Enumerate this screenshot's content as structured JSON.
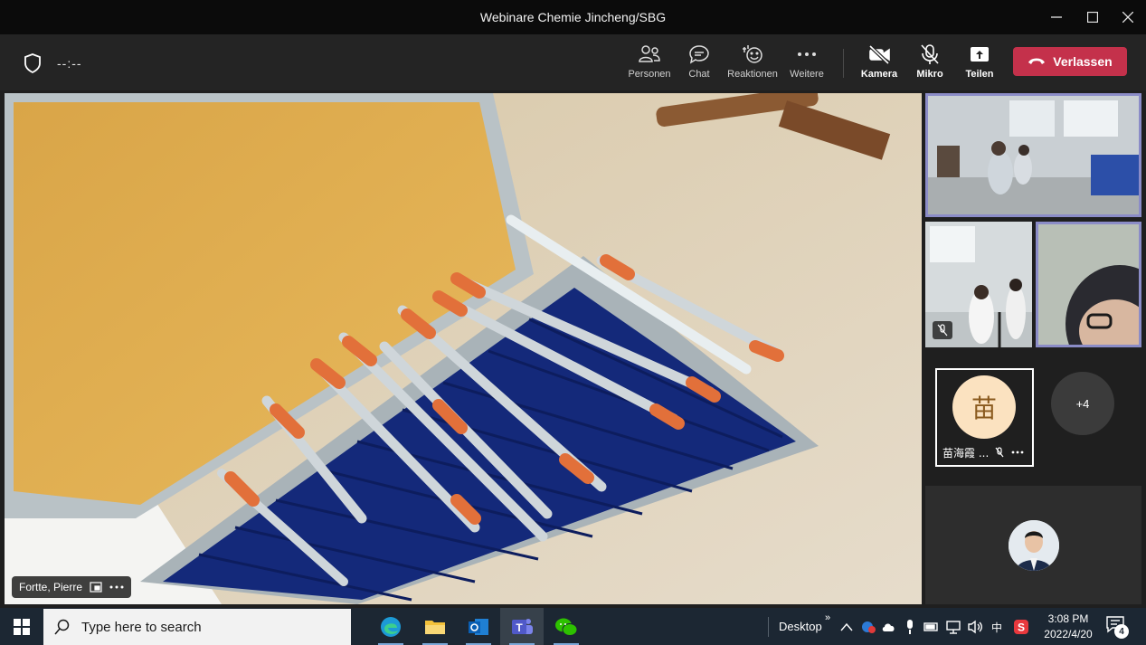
{
  "window": {
    "title": "Webinare Chemie Jincheng/SBG"
  },
  "meeting": {
    "timer": "--:--",
    "toolbar": [
      {
        "id": "people",
        "label": "Personen"
      },
      {
        "id": "chat",
        "label": "Chat"
      },
      {
        "id": "reactions",
        "label": "Reaktionen"
      },
      {
        "id": "more",
        "label": "Weitere"
      },
      {
        "id": "camera",
        "label": "Kamera"
      },
      {
        "id": "mic",
        "label": "Mikro"
      },
      {
        "id": "share",
        "label": "Teilen"
      }
    ],
    "leave_label": "Verlassen",
    "leave_color": "#c4314b"
  },
  "stage": {
    "speaker_name": "Fortte, Pierre"
  },
  "participants": {
    "avatar_initial": "苗",
    "avatar_name": "苗海霞 ...",
    "overflow_count": "+4",
    "selected_border_color": "#8b8cc7"
  },
  "taskbar": {
    "search_placeholder": "Type here to search",
    "desktop_label": "Desktop",
    "ime_label": "中",
    "time": "3:08 PM",
    "date": "2022/4/20",
    "notification_count": "4"
  }
}
